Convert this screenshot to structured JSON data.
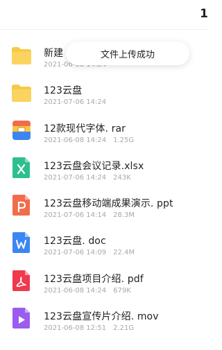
{
  "header": {
    "title_fragment": "1"
  },
  "toast": {
    "message": "文件上传成功"
  },
  "files": [
    {
      "name": "新建",
      "date": "2021-06-08 14:24",
      "size": "",
      "icon": "folder-icon"
    },
    {
      "name": "123云盘",
      "date": "2021-07-06 14:24",
      "size": "",
      "icon": "folder-icon"
    },
    {
      "name": "12款现代字体. rar",
      "date": "2021-06-08 14:24",
      "size": "1.25G",
      "icon": "archive-icon"
    },
    {
      "name": "123云盘会议记录.xlsx",
      "date": "2021-07-06 14:24",
      "size": "243K",
      "icon": "excel-icon"
    },
    {
      "name": "123云盘移动端成果演示. ppt",
      "date": "2021-07-06 14:14",
      "size": "28.3M",
      "icon": "ppt-icon"
    },
    {
      "name": "123云盘. doc",
      "date": "2021-07-06 14:09",
      "size": "22.4M",
      "icon": "word-icon"
    },
    {
      "name": "123云盘项目介绍. pdf",
      "date": "2021-06-08 14:24",
      "size": "679K",
      "icon": "pdf-icon"
    },
    {
      "name": "123云盘宣传片介绍. mov",
      "date": "2021-06-08 12:51",
      "size": "2.21G",
      "icon": "video-icon"
    }
  ],
  "colors": {
    "folder": "#f7c948",
    "excel": "#2fbf8f",
    "ppt": "#f26b4a",
    "word": "#3b86f2",
    "pdf": "#f0394d",
    "video": "#9b5cf0"
  }
}
